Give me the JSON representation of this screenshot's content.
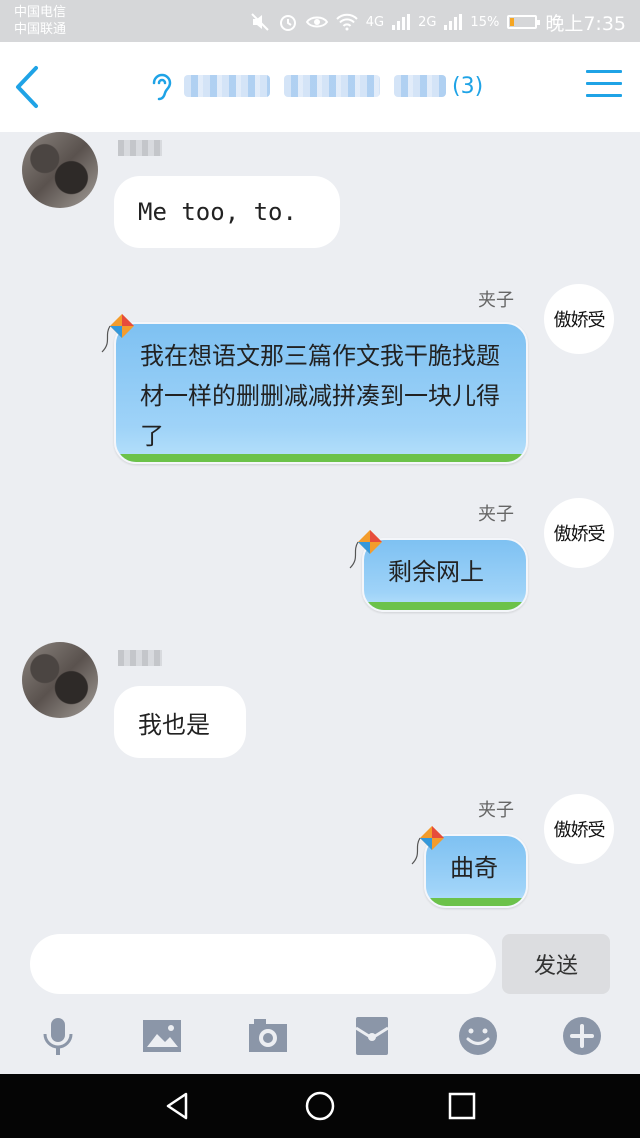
{
  "status_bar": {
    "carrier_1": "中国电信",
    "carrier_2": "中国联通",
    "network_1": "4G",
    "network_2": "2G",
    "battery": "15%",
    "time": "晚上7:35",
    "battery_level": 0.15
  },
  "header": {
    "member_count": "(3)",
    "icons": [
      "back-arrow-icon",
      "ear-icon",
      "menu-icon"
    ]
  },
  "messages": [
    {
      "side": "left",
      "text": "Me too, to."
    },
    {
      "side": "right",
      "sender": "夹子",
      "avatar_text": "傲娇受",
      "text": "我在想语文那三篇作文我干脆找题材一样的删删减减拼凑到一块儿得了"
    },
    {
      "side": "right",
      "sender": "夹子",
      "avatar_text": "傲娇受",
      "text": "剩余网上"
    },
    {
      "side": "left",
      "text": "我也是"
    },
    {
      "side": "right",
      "sender": "夹子",
      "avatar_text": "傲娇受",
      "text": "曲奇"
    }
  ],
  "input": {
    "value": "",
    "send_label": "发送"
  },
  "toolbar": [
    "microphone-icon",
    "image-icon",
    "camera-icon",
    "red-packet-icon",
    "emoji-icon",
    "plus-icon"
  ],
  "navbar": [
    "nav-back-icon",
    "nav-home-icon",
    "nav-recent-icon"
  ],
  "colors": {
    "accent": "#1fa3e6",
    "bubble_sky": "#7ec1f2",
    "grass": "#6cc24a",
    "background": "#eceef2"
  }
}
